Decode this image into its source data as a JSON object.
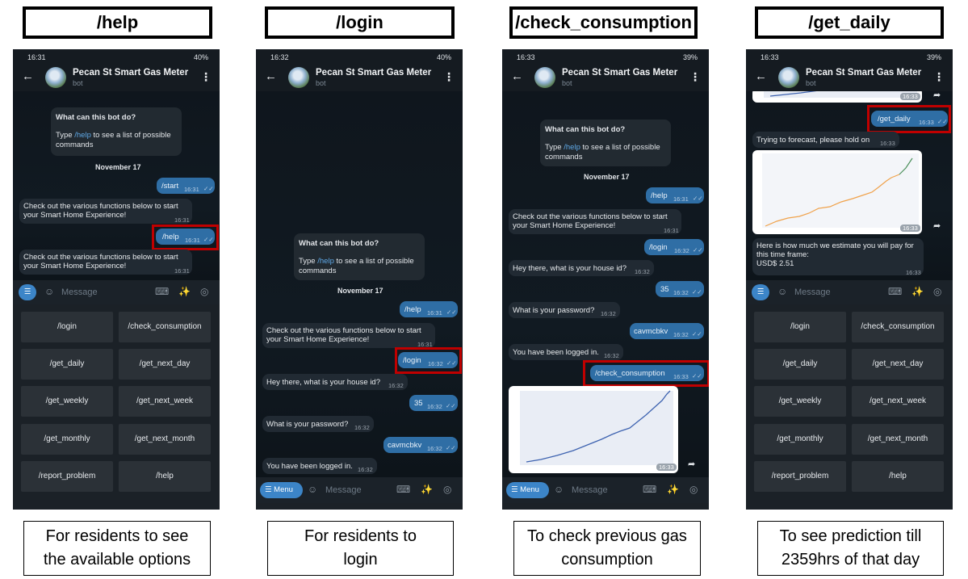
{
  "colors": {
    "accent": "#2f6ea5",
    "highlight": "#c00000",
    "menu": "#3c85c8"
  },
  "headers": [
    "/help",
    "/login",
    "/check_consumption",
    "/get_daily"
  ],
  "captions": [
    [
      "For residents to see",
      "the available options"
    ],
    [
      "For residents to",
      "login"
    ],
    [
      "To check previous gas",
      "consumption"
    ],
    [
      "To see prediction till",
      "2359hrs of that day"
    ]
  ],
  "bot": {
    "name": "Pecan St Smart Gas Meter",
    "type": "bot"
  },
  "status": {
    "p1": {
      "time": "16:31",
      "battery": "40%"
    },
    "p2": {
      "time": "16:32",
      "battery": "40%"
    },
    "p3": {
      "time": "16:33",
      "battery": "39%"
    },
    "p4": {
      "time": "16:33",
      "battery": "39%"
    }
  },
  "intro": {
    "question": "What can this bot do?",
    "type_word": "Type",
    "cmd": "/help",
    "rest": "to see a list of possible commands"
  },
  "date_label": "November 17",
  "messages": {
    "start": "/start",
    "help": "/help",
    "login": "/login",
    "check_consumption": "/check_consumption",
    "get_daily": "/get_daily",
    "functions": "Check out the various functions below to start your Smart Home Experience!",
    "house_q": "Hey there, what is your house id?",
    "house_id": "35",
    "pwd_q": "What is your password?",
    "pwd": "cavmcbkv",
    "logged_in": "You have been logged in.",
    "forecast_wait": "Trying to forecast, please hold on",
    "estimate_1": "Here is how much we estimate you will pay for",
    "estimate_2": "this time frame:",
    "estimate_value": "USD$ 2.51"
  },
  "times": {
    "t1631": "16:31",
    "t1632": "16:32",
    "t1633": "16:33"
  },
  "input": {
    "placeholder": "Message",
    "menu_label": "Menu"
  },
  "keyboard": [
    [
      "/login",
      "/check_consumption"
    ],
    [
      "/get_daily",
      "/get_next_day"
    ],
    [
      "/get_weekly",
      "/get_next_week"
    ],
    [
      "/get_monthly",
      "/get_next_month"
    ],
    [
      "/report_problem",
      "/help"
    ]
  ],
  "icons": [
    "back-arrow-icon",
    "kebab-menu-icon",
    "menu-icon",
    "emoji-icon",
    "keyboard-icon",
    "attach-icon",
    "camera-icon",
    "read-check-icon",
    "forward-icon"
  ]
}
